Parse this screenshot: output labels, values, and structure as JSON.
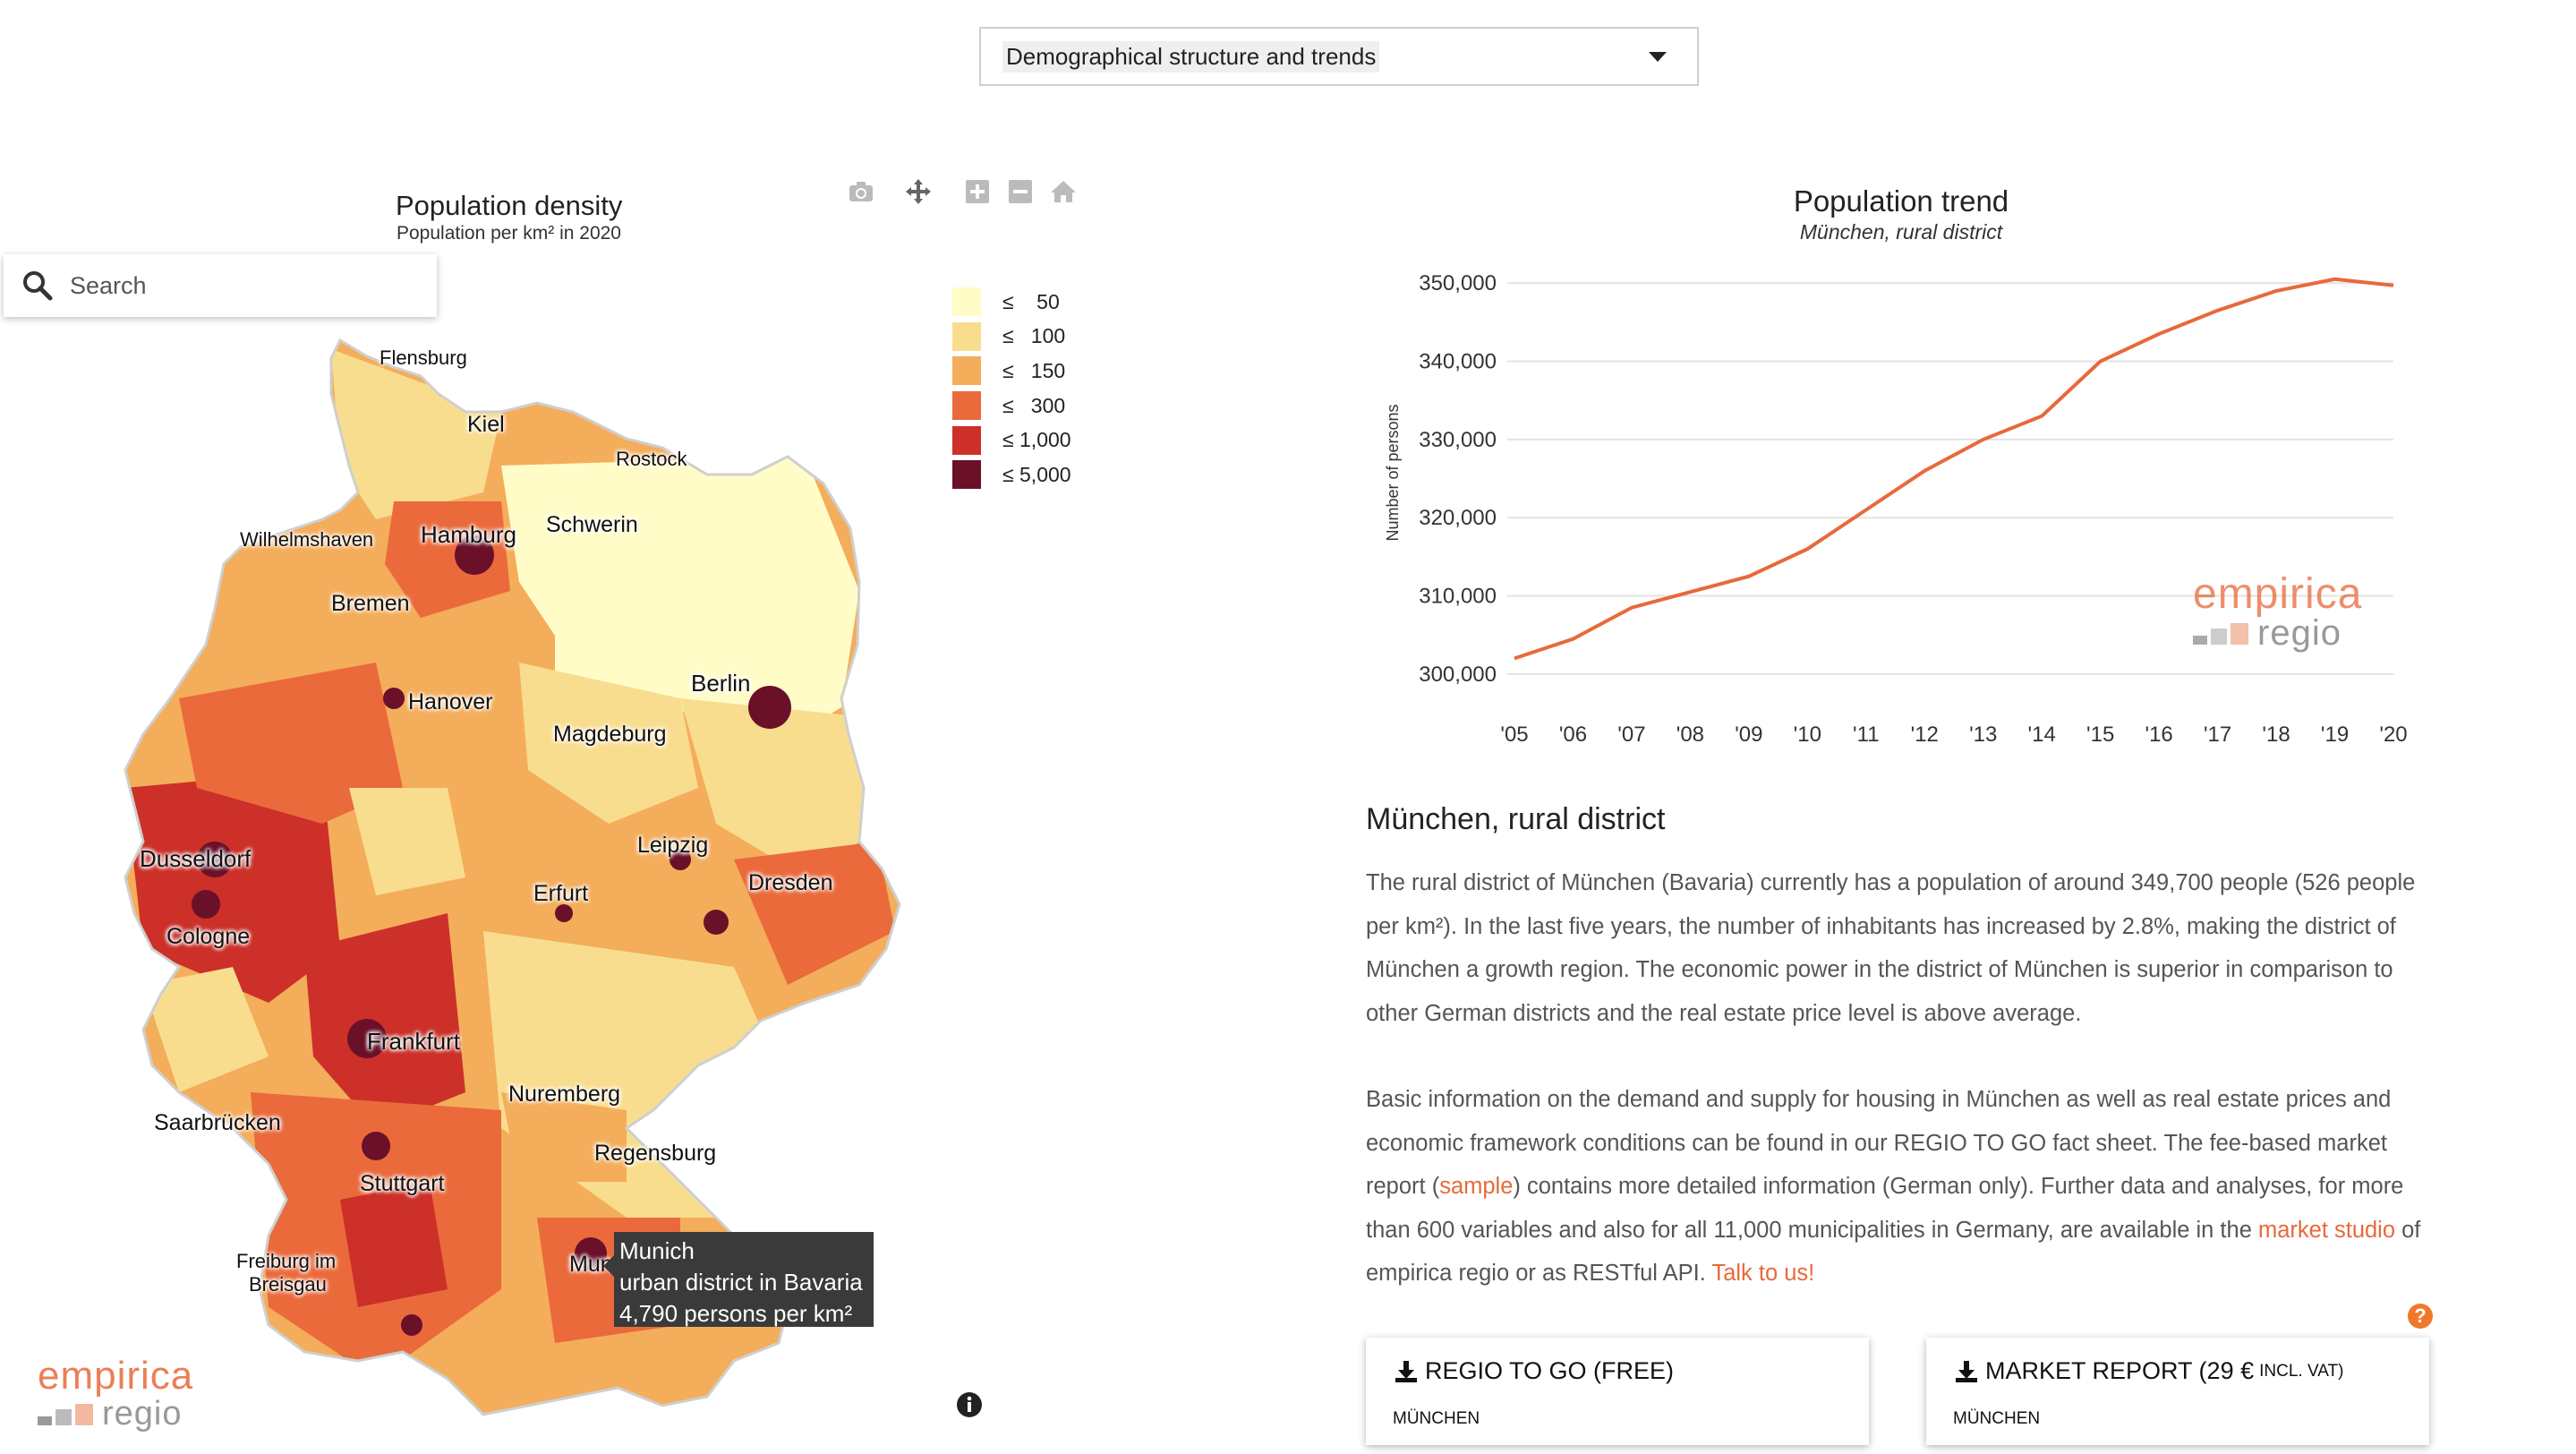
{
  "selector": {
    "value": "Demographical structure and trends"
  },
  "map": {
    "title": "Population density",
    "subtitle": "Population per km² in 2020",
    "search_placeholder": "Search",
    "legend": [
      {
        "label": "≤    50",
        "color": "#fffcc8"
      },
      {
        "label": "≤   100",
        "color": "#f9dd8f"
      },
      {
        "label": "≤   150",
        "color": "#f4ad5a"
      },
      {
        "label": "≤   300",
        "color": "#ea6a3c"
      },
      {
        "label": "≤ 1,000",
        "color": "#cc3028"
      },
      {
        "label": "≤ 5,000",
        "color": "#6a1028"
      }
    ],
    "cities": {
      "flensburg": "Flensburg",
      "kiel": "Kiel",
      "rostock": "Rostock",
      "wilhelmshaven": "Wilhelmshaven",
      "hamburg": "Hamburg",
      "schwerin": "Schwerin",
      "bremen": "Bremen",
      "berlin": "Berlin",
      "hanover": "Hanover",
      "magdeburg": "Magdeburg",
      "leipzig": "Leipzig",
      "dusseldorf": "Dusseldorf",
      "dresden": "Dresden",
      "erfurt": "Erfurt",
      "cologne": "Cologne",
      "frankfurt": "Frankfurt",
      "nuremberg": "Nuremberg",
      "saarbruecken": "Saarbrücken",
      "regensburg": "Regensburg",
      "stuttgart": "Stuttgart",
      "freiburg_1": "Freiburg im",
      "freiburg_2": "Breisgau",
      "munich": "Mun"
    },
    "tooltip": {
      "name": "Munich",
      "type": "urban district in Bavaria",
      "value": "4,790 persons per km²"
    }
  },
  "brand": {
    "name": "empirica",
    "sub": "regio",
    "color": "#e8693a"
  },
  "chart_data": {
    "type": "line",
    "title": "Population trend",
    "subtitle": "München, rural district",
    "ylabel": "Number of persons",
    "x": [
      "'05",
      "'06",
      "'07",
      "'08",
      "'09",
      "'10",
      "'11",
      "'12",
      "'13",
      "'14",
      "'15",
      "'16",
      "'17",
      "'18",
      "'19",
      "'20"
    ],
    "series": [
      {
        "values": [
          302000,
          304500,
          308500,
          310500,
          312500,
          316000,
          321000,
          326000,
          330000,
          333000,
          340000,
          343500,
          346500,
          349000,
          350500,
          349700
        ],
        "color": "#e8693a"
      }
    ],
    "yticks": [
      300000,
      310000,
      320000,
      330000,
      340000,
      350000
    ],
    "ytick_labels": [
      "300,000",
      "310,000",
      "320,000",
      "330,000",
      "340,000",
      "350,000"
    ],
    "ylim": [
      298500,
      353000
    ],
    "grid": true
  },
  "district": {
    "heading": "München, rural district",
    "para1": "The rural district of München (Bavaria) currently has a population of around 349,700 people (526 people per km²). In the last five years, the number of inhabitants has increased by 2.8%, making the district of München a growth region. The economic power in the district of München is superior in comparison to other German districts and the real estate price level is above average.",
    "para2_a": "Basic information on the demand and supply for housing in München as well as real estate prices and economic framework conditions can be found in our REGIO TO GO fact sheet. The fee-based market report (",
    "para2_link1": "sample",
    "para2_b": ") contains more detailed information (German only). Further data and analyses, for more than 600 variables and also for all 11,000 municipalities in Germany, are available in the ",
    "para2_link2": "market studio",
    "para2_c": " of empirica regio or as RESTful API. ",
    "para2_link3": "Talk to us!"
  },
  "help_icon": "?",
  "downloads": [
    {
      "title": "REGIO TO GO (FREE)",
      "title_small": "",
      "sub": "MÜNCHEN"
    },
    {
      "title": "MARKET REPORT (29 €",
      "title_small": "INCL. VAT)",
      "sub": "MÜNCHEN"
    }
  ]
}
